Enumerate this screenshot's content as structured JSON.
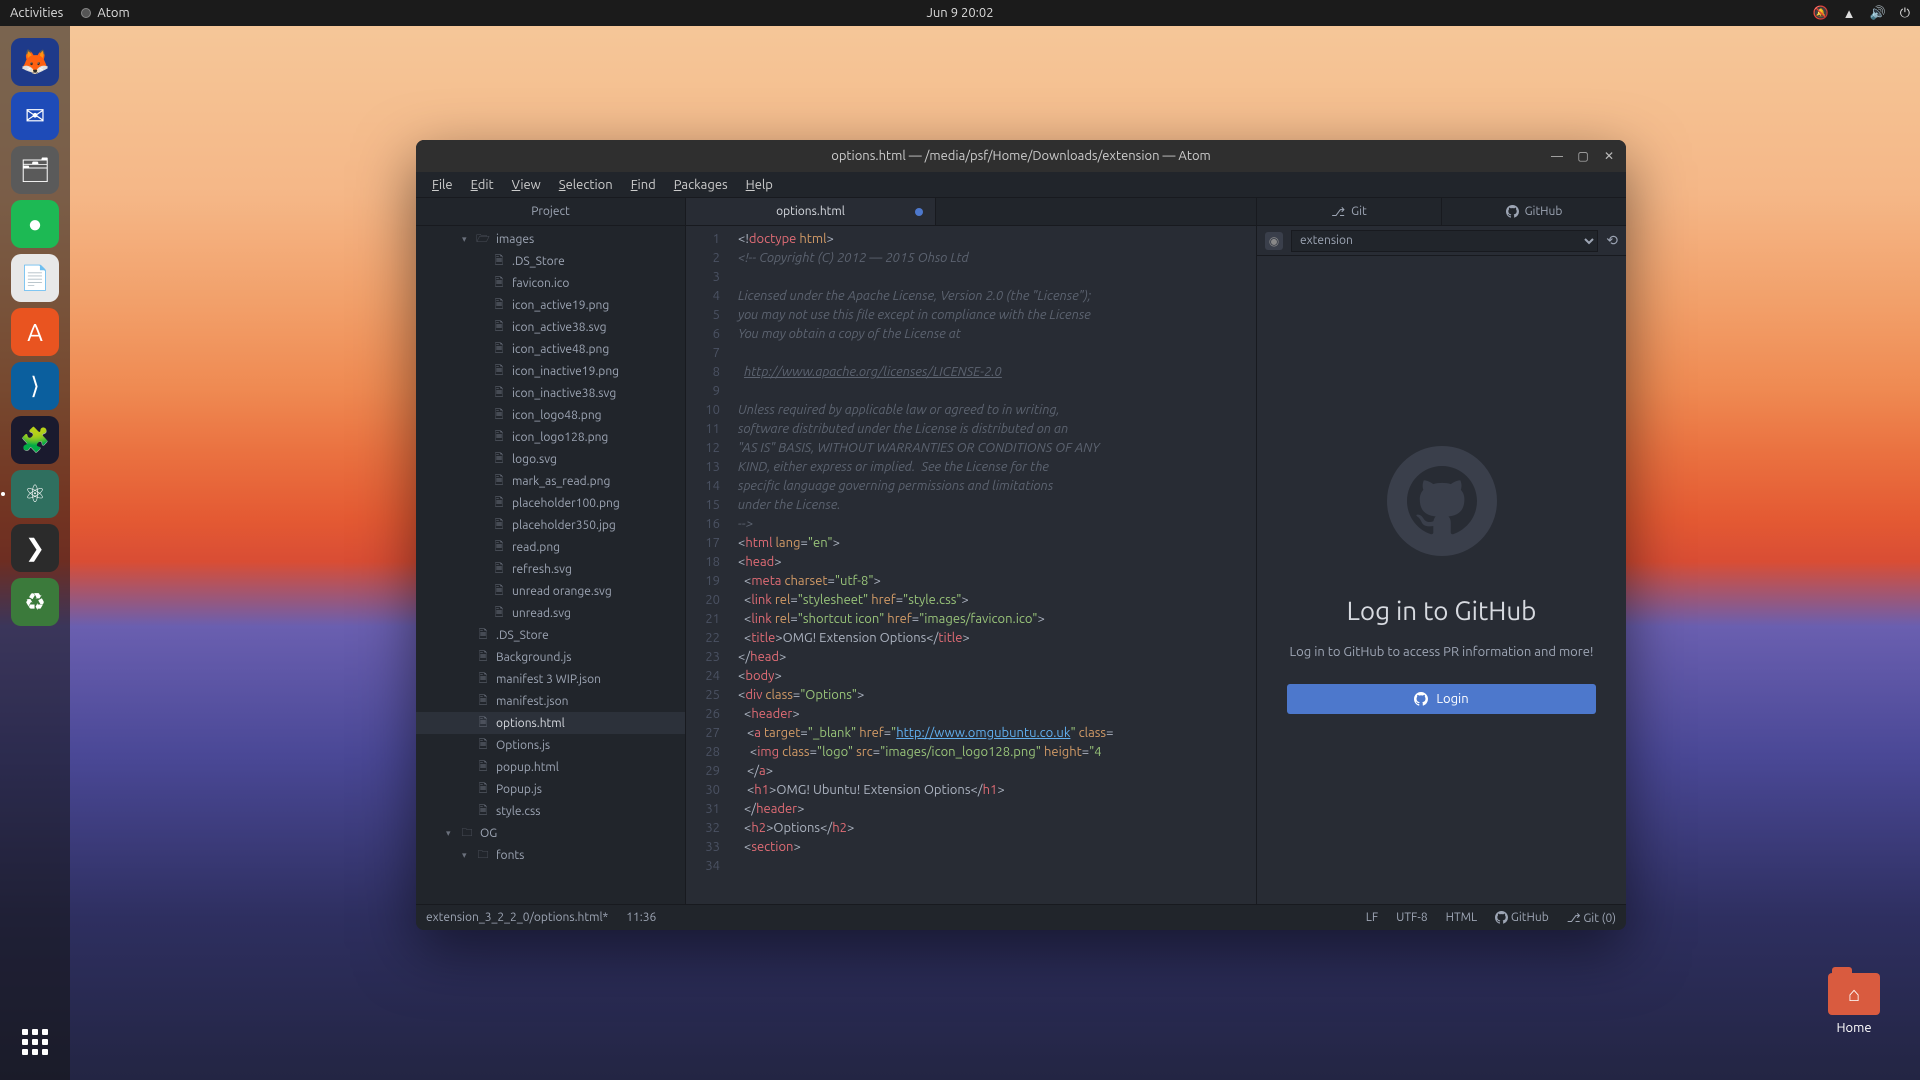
{
  "topbar": {
    "activities": "Activities",
    "app_name": "Atom",
    "clock": "Jun 9  20:02"
  },
  "dock": {
    "items": [
      {
        "name": "firefox",
        "bg": "#1e3a8a",
        "glyph": "🦊"
      },
      {
        "name": "thunderbird",
        "bg": "#1e4bb8",
        "glyph": "✉"
      },
      {
        "name": "files",
        "bg": "#5a5a5a",
        "glyph": "🗂"
      },
      {
        "name": "spotify",
        "bg": "#1db954",
        "glyph": "●"
      },
      {
        "name": "libreoffice",
        "bg": "#e8e8e8",
        "glyph": "📄"
      },
      {
        "name": "software",
        "bg": "#e95420",
        "glyph": "A"
      },
      {
        "name": "vscode",
        "bg": "#0b5f9e",
        "glyph": "⟩"
      },
      {
        "name": "extension",
        "bg": "#1a1a2e",
        "glyph": "🧩"
      },
      {
        "name": "atom",
        "bg": "#2f6f5f",
        "glyph": "⚛",
        "active": true
      },
      {
        "name": "terminal",
        "bg": "#2b2b2b",
        "glyph": "❯"
      },
      {
        "name": "trash",
        "bg": "#3b7a3b",
        "glyph": "♻"
      }
    ]
  },
  "desktop_icon": {
    "label": "Home"
  },
  "window": {
    "title": "options.html — /media/psf/Home/Downloads/extension — Atom",
    "menu": [
      "File",
      "Edit",
      "View",
      "Selection",
      "Find",
      "Packages",
      "Help"
    ]
  },
  "sidebar": {
    "header": "Project",
    "nodes": [
      {
        "level": 1,
        "kind": "folder-open",
        "caret": "▾",
        "label": "images"
      },
      {
        "level": 2,
        "kind": "file",
        "label": ".DS_Store"
      },
      {
        "level": 2,
        "kind": "file",
        "label": "favicon.ico"
      },
      {
        "level": 2,
        "kind": "file",
        "label": "icon_active19.png"
      },
      {
        "level": 2,
        "kind": "file",
        "label": "icon_active38.svg"
      },
      {
        "level": 2,
        "kind": "file",
        "label": "icon_active48.png"
      },
      {
        "level": 2,
        "kind": "file",
        "label": "icon_inactive19.png"
      },
      {
        "level": 2,
        "kind": "file",
        "label": "icon_inactive38.svg"
      },
      {
        "level": 2,
        "kind": "file",
        "label": "icon_logo48.png"
      },
      {
        "level": 2,
        "kind": "file",
        "label": "icon_logo128.png"
      },
      {
        "level": 2,
        "kind": "file",
        "label": "logo.svg"
      },
      {
        "level": 2,
        "kind": "file",
        "label": "mark_as_read.png"
      },
      {
        "level": 2,
        "kind": "file",
        "label": "placeholder100.png"
      },
      {
        "level": 2,
        "kind": "file",
        "label": "placeholder350.jpg"
      },
      {
        "level": 2,
        "kind": "file",
        "label": "read.png"
      },
      {
        "level": 2,
        "kind": "file",
        "label": "refresh.svg"
      },
      {
        "level": 2,
        "kind": "file",
        "label": "unread orange.svg"
      },
      {
        "level": 2,
        "kind": "file",
        "label": "unread.svg"
      },
      {
        "level": 1,
        "kind": "file",
        "label": ".DS_Store"
      },
      {
        "level": 1,
        "kind": "file",
        "label": "Background.js"
      },
      {
        "level": 1,
        "kind": "file",
        "label": "manifest 3 WIP.json"
      },
      {
        "level": 1,
        "kind": "file",
        "label": "manifest.json"
      },
      {
        "level": 1,
        "kind": "file",
        "label": "options.html",
        "selected": true
      },
      {
        "level": 1,
        "kind": "file",
        "label": "Options.js"
      },
      {
        "level": 1,
        "kind": "file",
        "label": "popup.html"
      },
      {
        "level": 1,
        "kind": "file",
        "label": "Popup.js"
      },
      {
        "level": 1,
        "kind": "file",
        "label": "style.css"
      },
      {
        "level": 0,
        "kind": "folder",
        "caret": "▾",
        "label": "OG"
      },
      {
        "level": 1,
        "kind": "folder",
        "caret": "▾",
        "label": "fonts"
      }
    ]
  },
  "editor": {
    "tab_label": "options.html",
    "dirty": true,
    "lines": [
      {
        "n": 1,
        "html": "<span class='c-punct'>&lt;!</span><span class='c-tag'>doctype</span> <span class='c-attr'>html</span><span class='c-punct'>&gt;</span>"
      },
      {
        "n": 2,
        "html": "<span class='c-comment'>&lt;!-- Copyright (C) 2012 — 2015 Ohso Ltd</span>"
      },
      {
        "n": 3,
        "html": ""
      },
      {
        "n": 4,
        "html": "<span class='c-comment'>Licensed under the Apache License, Version 2.0 (the \"License\");</span>"
      },
      {
        "n": 5,
        "html": "<span class='c-comment'>you may not use this file except in compliance with the License</span>"
      },
      {
        "n": 6,
        "html": "<span class='c-comment'>You may obtain a copy of the License at</span>"
      },
      {
        "n": 7,
        "html": ""
      },
      {
        "n": 8,
        "html": "  <span class='c-link'>http://www.apache.org/licenses/LICENSE-2.0</span>"
      },
      {
        "n": 9,
        "html": ""
      },
      {
        "n": 10,
        "html": "<span class='c-comment'>Unless required by applicable law or agreed to in writing,</span>"
      },
      {
        "n": 11,
        "html": "<span class='c-comment'>software distributed under the License is distributed on an</span>"
      },
      {
        "n": 12,
        "html": "<span class='c-comment'>\"AS IS\" BASIS, WITHOUT WARRANTIES OR CONDITIONS OF ANY</span>"
      },
      {
        "n": 13,
        "html": "<span class='c-comment'>KIND, either express or implied.  See the License for the</span>"
      },
      {
        "n": 14,
        "html": "<span class='c-comment'>specific language governing permissions and limitations</span>"
      },
      {
        "n": 15,
        "html": "<span class='c-comment'>under the License.</span>"
      },
      {
        "n": 16,
        "html": "<span class='c-comment'>--&gt;</span>"
      },
      {
        "n": 17,
        "html": "<span class='c-punct'>&lt;</span><span class='c-tag'>html</span> <span class='c-attr'>lang</span>=<span class='c-str'>\"en\"</span><span class='c-punct'>&gt;</span>"
      },
      {
        "n": 18,
        "html": "<span class='c-punct'>&lt;</span><span class='c-tag'>head</span><span class='c-punct'>&gt;</span>"
      },
      {
        "n": 19,
        "html": "  <span class='c-punct'>&lt;</span><span class='c-tag'>meta</span> <span class='c-attr'>charset</span>=<span class='c-str'>\"utf-8\"</span><span class='c-punct'>&gt;</span>"
      },
      {
        "n": 20,
        "html": "  <span class='c-punct'>&lt;</span><span class='c-tag'>link</span> <span class='c-attr'>rel</span>=<span class='c-str'>\"stylesheet\"</span> <span class='c-attr'>href</span>=<span class='c-str'>\"style.css\"</span><span class='c-punct'>&gt;</span>"
      },
      {
        "n": 21,
        "html": "  <span class='c-punct'>&lt;</span><span class='c-tag'>link</span> <span class='c-attr'>rel</span>=<span class='c-str'>\"shortcut icon\"</span> <span class='c-attr'>href</span>=<span class='c-str'>\"images/favicon.ico\"</span><span class='c-punct'>&gt;</span>"
      },
      {
        "n": 22,
        "html": "  <span class='c-punct'>&lt;</span><span class='c-tag'>title</span><span class='c-punct'>&gt;</span>OMG! Extension Options<span class='c-punct'>&lt;/</span><span class='c-tag'>title</span><span class='c-punct'>&gt;</span>"
      },
      {
        "n": 23,
        "html": "<span class='c-punct'>&lt;/</span><span class='c-tag'>head</span><span class='c-punct'>&gt;</span>"
      },
      {
        "n": 24,
        "html": "<span class='c-punct'>&lt;</span><span class='c-tag'>body</span><span class='c-punct'>&gt;</span>"
      },
      {
        "n": 25,
        "html": "<span class='c-punct'>&lt;</span><span class='c-tag'>div</span> <span class='c-attr'>class</span>=<span class='c-str'>\"Options\"</span><span class='c-punct'>&gt;</span>"
      },
      {
        "n": 26,
        "html": "  <span class='c-punct'>&lt;</span><span class='c-tag'>header</span><span class='c-punct'>&gt;</span>"
      },
      {
        "n": 27,
        "html": "   <span class='c-punct'>&lt;</span><span class='c-tag'>a</span> <span class='c-attr'>target</span>=<span class='c-str'>\"_blank\"</span> <span class='c-attr'>href</span>=<span class='c-str'>\"</span><span class='c-link2'>http://www.omgubuntu.co.uk</span><span class='c-str'>\"</span> <span class='c-attr'>class</span>=</span>"
      },
      {
        "n": 28,
        "html": "    <span class='c-punct'>&lt;</span><span class='c-tag'>img</span> <span class='c-attr'>class</span>=<span class='c-str'>\"logo\"</span> <span class='c-attr'>src</span>=<span class='c-str'>\"images/icon_logo128.png\"</span> <span class='c-attr'>height</span>=<span class='c-str'>\"4</span>"
      },
      {
        "n": 29,
        "html": "   <span class='c-punct'>&lt;/</span><span class='c-tag'>a</span><span class='c-punct'>&gt;</span>"
      },
      {
        "n": 30,
        "html": "   <span class='c-punct'>&lt;</span><span class='c-tag'>h1</span><span class='c-punct'>&gt;</span>OMG! Ubuntu! Extension Options<span class='c-punct'>&lt;/</span><span class='c-tag'>h1</span><span class='c-punct'>&gt;</span>"
      },
      {
        "n": 31,
        "html": "  <span class='c-punct'>&lt;/</span><span class='c-tag'>header</span><span class='c-punct'>&gt;</span>"
      },
      {
        "n": 32,
        "html": "  <span class='c-punct'>&lt;</span><span class='c-tag'>h2</span><span class='c-punct'>&gt;</span>Options<span class='c-punct'>&lt;/</span><span class='c-tag'>h2</span><span class='c-punct'>&gt;</span>"
      },
      {
        "n": 33,
        "html": "  <span class='c-punct'>&lt;</span><span class='c-tag'>section</span><span class='c-punct'>&gt;</span>"
      },
      {
        "n": 34,
        "html": ""
      }
    ]
  },
  "right": {
    "tab_git": "Git",
    "tab_github": "GitHub",
    "repo_selected": "extension",
    "title": "Log in to GitHub",
    "desc": "Log in to GitHub to access PR information and more!",
    "login_btn": "Login"
  },
  "statusbar": {
    "path": "extension_3_2_2_0/options.html*",
    "cursor": "11:36",
    "eol": "LF",
    "encoding": "UTF-8",
    "language": "HTML",
    "github": "GitHub",
    "git": "Git (0)"
  }
}
